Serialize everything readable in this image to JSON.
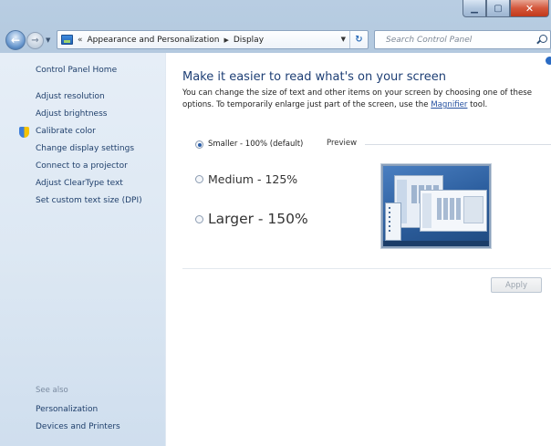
{
  "window": {
    "caption": {
      "minimize_icon": "minimize-icon",
      "maximize_icon": "maximize-icon",
      "close_icon": "close-icon"
    }
  },
  "address": {
    "overflow_chevron": "«",
    "crumbs": [
      "Appearance and Personalization",
      "Display"
    ],
    "refresh_icon": "refresh-icon"
  },
  "search": {
    "placeholder": "Search Control Panel"
  },
  "sidebar": {
    "home": "Control Panel Home",
    "items": [
      {
        "label": "Adjust resolution"
      },
      {
        "label": "Adjust brightness"
      },
      {
        "label": "Calibrate color",
        "icon": "shield-icon"
      },
      {
        "label": "Change display settings"
      },
      {
        "label": "Connect to a projector"
      },
      {
        "label": "Adjust ClearType text"
      },
      {
        "label": "Set custom text size (DPI)"
      }
    ],
    "see_also": "See also",
    "see_also_items": [
      {
        "label": "Personalization"
      },
      {
        "label": "Devices and Printers"
      }
    ]
  },
  "main": {
    "title": "Make it easier to read what's on your screen",
    "description_before": "You can change the size of text and other items on your screen by choosing one of these options. To temporarily enlarge just part of the screen, use the ",
    "description_link": "Magnifier",
    "description_after": " tool.",
    "options": [
      {
        "label": "Smaller - 100% (default)",
        "selected": true
      },
      {
        "label": "Medium - 125%",
        "selected": false
      },
      {
        "label": "Larger - 150%",
        "selected": false
      }
    ],
    "preview_label": "Preview",
    "apply_label": "Apply",
    "apply_enabled": false
  },
  "colors": {
    "title_blue": "#1e3f75",
    "link_blue": "#1f3f6b",
    "sidebar_bg": "#dde8f3"
  }
}
